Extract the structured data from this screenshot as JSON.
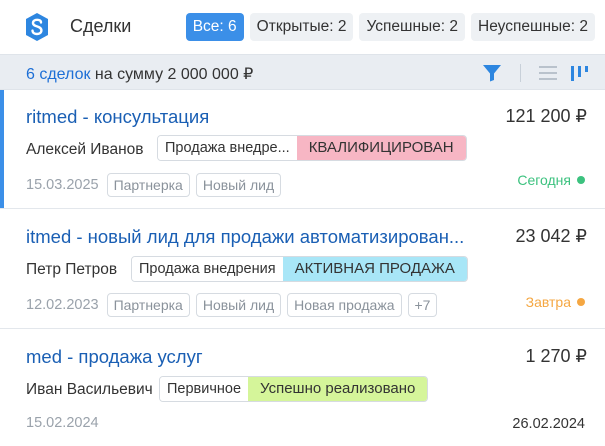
{
  "header": {
    "title": "Сделки",
    "filters": [
      {
        "label": "Все: 6",
        "active": true
      },
      {
        "label": "Открытые: 2",
        "active": false
      },
      {
        "label": "Успешные: 2",
        "active": false
      },
      {
        "label": "Неуспешные: 2",
        "active": false
      }
    ]
  },
  "summary": {
    "count": "6 сделок",
    "rest": " на сумму 2 000 000 ₽"
  },
  "icons": {
    "logo": "app-logo-icon",
    "filter": "filter-icon",
    "list": "list-view-icon",
    "kanban": "kanban-view-icon"
  },
  "colors": {
    "accent": "#3b8fe8",
    "stage_qualified": "#f7b6c4",
    "stage_active": "#a8e6f7",
    "stage_success": "#d5f59a",
    "due_today": "#3cc27f",
    "due_tomorrow": "#f5a742"
  },
  "deals": [
    {
      "title": "ritmed - консультация",
      "amount": "121 200 ₽",
      "person": "Алексей Иванов",
      "pipeline": "Продажа внедре...",
      "stage": "КВАЛИФИЦИРОВАН",
      "date": "15.03.2025",
      "tags": [
        "Партнерка",
        "Новый лид"
      ],
      "due": "Сегодня",
      "close_date": ""
    },
    {
      "title": "itmed - новый лид для продажи автоматизирован...",
      "amount": "23 042 ₽",
      "person": "Петр Петров",
      "pipeline": "Продажа внедрения",
      "stage": "АКТИВНАЯ ПРОДАЖА",
      "date": "12.02.2023",
      "tags": [
        "Партнерка",
        "Новый лид",
        "Новая продажа",
        "+7"
      ],
      "due": "Завтра",
      "close_date": ""
    },
    {
      "title": "med - продажа услуг",
      "amount": "1 270 ₽",
      "person": "Иван Васильевич",
      "pipeline": "Первичное",
      "stage": "Успешно реализовано",
      "date": "15.02.2024",
      "tags": [],
      "due": "",
      "close_date": "26.02.2024"
    }
  ]
}
